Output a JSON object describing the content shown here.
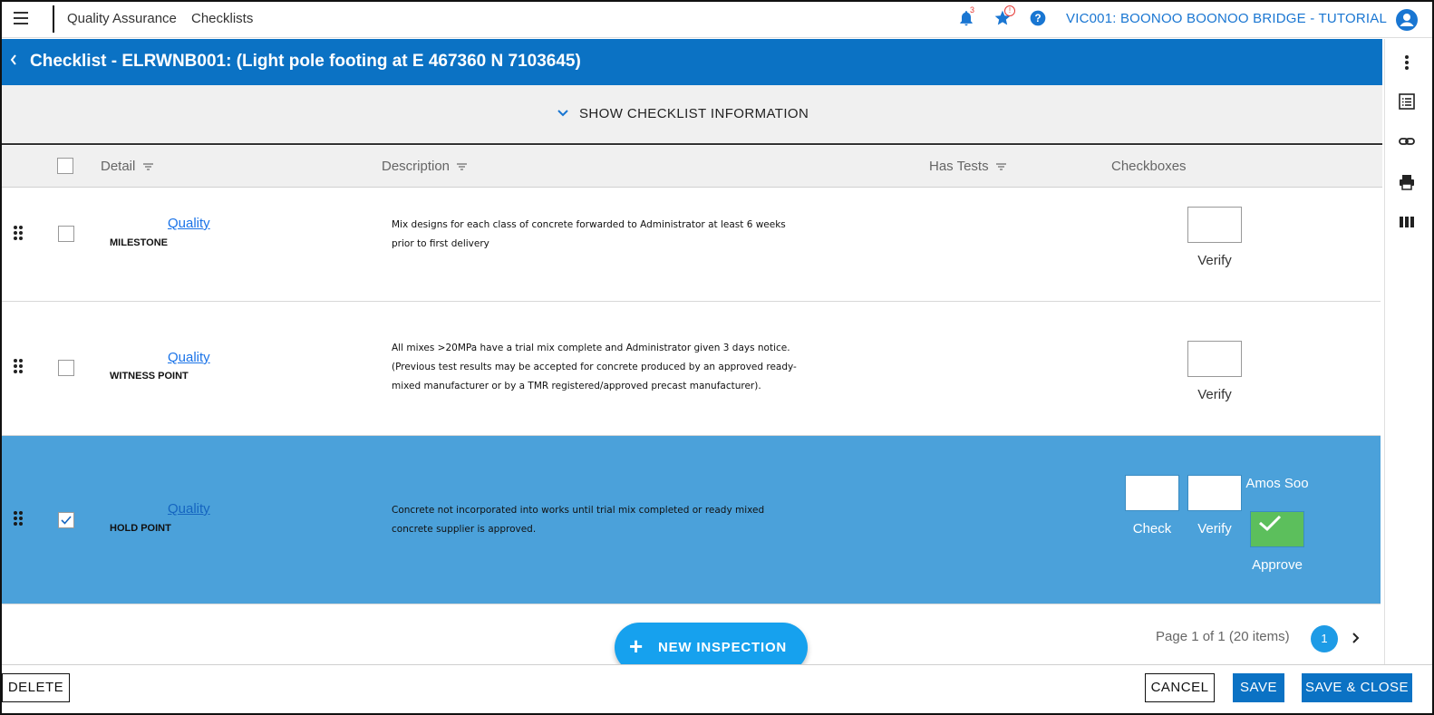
{
  "topbar": {
    "module": "Quality Assurance",
    "page": "Checklists",
    "notification_count": "3",
    "favorites_badge": "!",
    "project": "VIC001: BOONOO BOONOO BRIDGE - TUTORIAL"
  },
  "header": {
    "title": "Checklist - ELRWNB001: (Light pole footing at E 467360 N 7103645)"
  },
  "info_toggle": "SHOW CHECKLIST INFORMATION",
  "table": {
    "columns": [
      "Detail",
      "Description",
      "Has Tests",
      "Checkboxes"
    ],
    "rows": [
      {
        "link": "Quality",
        "type": "MILESTONE",
        "description": "Mix designs for each class of concrete forwarded to Administrator at least 6 weeks prior to first delivery",
        "checkboxes": [
          "Verify"
        ],
        "selected": false
      },
      {
        "link": "Quality",
        "type": "WITNESS POINT",
        "description": "All mixes >20MPa have a trial mix complete and Administrator given 3 days notice.  (Previous test results may be accepted for concrete produced by an approved ready-mixed manufacturer or by a TMR registered/approved precast manufacturer).",
        "checkboxes": [
          "Verify"
        ],
        "selected": false
      },
      {
        "link": "Quality",
        "type": "HOLD POINT",
        "description": "Concrete not incorporated into works until trial mix completed or ready mixed concrete supplier is approved.",
        "checkboxes": [
          "Check",
          "Verify",
          "Approve"
        ],
        "signer": "Amos Soo",
        "selected": true
      }
    ]
  },
  "pagination": {
    "summary": "Page 1 of 1 (20 items)",
    "current": "1"
  },
  "fab": {
    "label": "NEW INSPECTION"
  },
  "footer": {
    "delete": "DELETE",
    "cancel": "CANCEL",
    "save": "SAVE",
    "save_close": "SAVE & CLOSE"
  },
  "colors": {
    "brand_blue": "#0b72c4",
    "selected_row": "#4ba1da",
    "approve_green": "#5cbf5c",
    "fab_blue": "#16a1ee"
  }
}
